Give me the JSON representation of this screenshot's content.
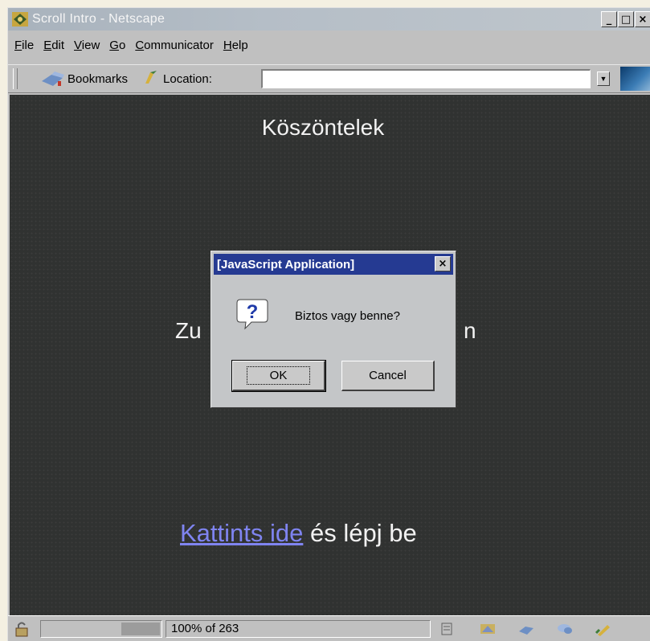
{
  "window": {
    "title": "Scroll Intro - Netscape",
    "controls": {
      "minimize": "_",
      "maximize": "□",
      "close": "×"
    }
  },
  "menubar": {
    "items": [
      {
        "label": "File",
        "mnemonic": "F",
        "rest": "ile"
      },
      {
        "label": "Edit",
        "mnemonic": "E",
        "rest": "dit"
      },
      {
        "label": "View",
        "mnemonic": "V",
        "rest": "iew"
      },
      {
        "label": "Go",
        "mnemonic": "G",
        "rest": "o"
      },
      {
        "label": "Communicator",
        "mnemonic": "C",
        "rest": "ommunicator"
      },
      {
        "label": "Help",
        "mnemonic": "H",
        "rest": "elp"
      }
    ]
  },
  "toolbar": {
    "bookmarks_label": "Bookmarks",
    "location_label": "Location:",
    "location_value": ""
  },
  "page": {
    "welcome": "Köszöntelek",
    "partial_left": "Zu",
    "partial_right": "n",
    "link_text": "Kattints ide",
    "after_link": " és lépj be"
  },
  "dialog": {
    "title": "[JavaScript Application]",
    "close": "×",
    "message": "Biztos vagy benne?",
    "ok_label": "OK",
    "cancel_label": "Cancel"
  },
  "statusbar": {
    "status_text": "100% of 263",
    "progress": 0.32
  },
  "colors": {
    "content_bg": "#303231",
    "dialog_title_bg": "#253a92",
    "link": "#7f84f0"
  },
  "icons": {
    "app": "netscape-n-icon",
    "bookmarks": "bookmarks-icon",
    "location": "location-icon",
    "dialog": "question-icon"
  }
}
